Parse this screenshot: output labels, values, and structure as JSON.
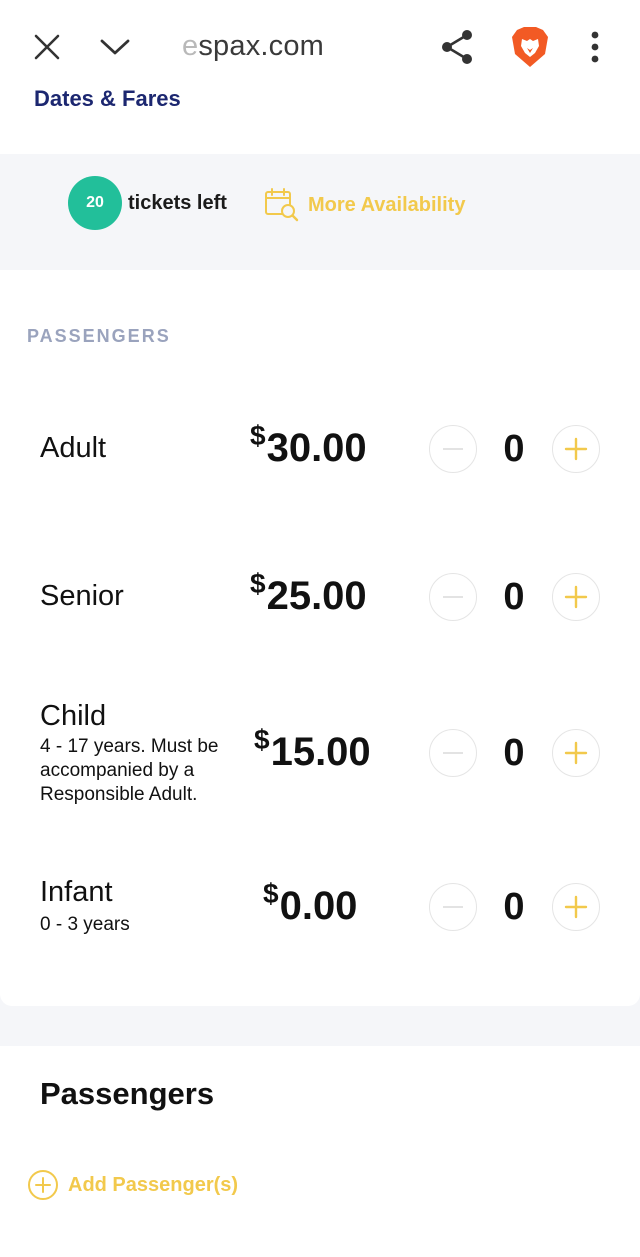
{
  "browser": {
    "url_faded": "e",
    "url_main": "spax.com",
    "icons": [
      "close-icon",
      "chevron-down-icon",
      "share-icon",
      "brave-lion-icon",
      "more-vert-icon"
    ]
  },
  "section": {
    "title": "Dates & Fares"
  },
  "availability": {
    "tickets_count": "20",
    "tickets_label": "tickets left",
    "more_label": "More Availability"
  },
  "passengers_pricing": {
    "label": "PASSENGERS",
    "fares": [
      {
        "name": "Adult",
        "description": "",
        "currency": "$",
        "price": "30.00",
        "quantity": "0"
      },
      {
        "name": "Senior",
        "description": "",
        "currency": "$",
        "price": "25.00",
        "quantity": "0"
      },
      {
        "name": "Child",
        "description": "4 - 17 years. Must be accompanied by a Responsible Adult.",
        "currency": "$",
        "price": "15.00",
        "quantity": "0"
      },
      {
        "name": "Infant",
        "description": "0 - 3 years",
        "currency": "$",
        "price": "0.00",
        "quantity": "0"
      }
    ]
  },
  "passengers": {
    "title": "Passengers",
    "add_label": "Add Passenger(s)"
  },
  "colors": {
    "accent": "#f2c94c",
    "badge": "#22bf9a",
    "heading": "#1c2770",
    "muted_label": "#9aa3bd"
  }
}
